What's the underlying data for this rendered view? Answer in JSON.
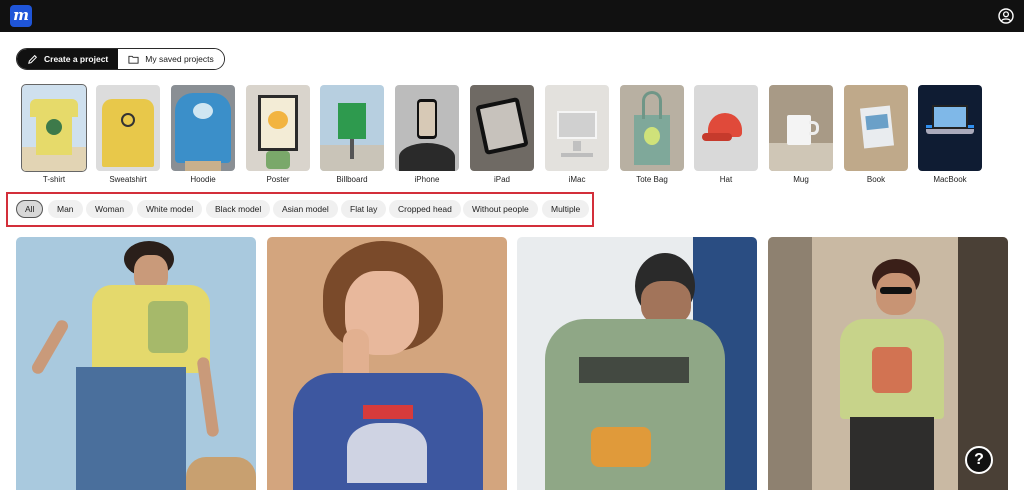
{
  "header": {
    "logo_letter": "m"
  },
  "projects": {
    "create_label": "Create a project",
    "saved_label": "My saved projects"
  },
  "categories": [
    {
      "label": "T-shirt"
    },
    {
      "label": "Sweatshirt"
    },
    {
      "label": "Hoodie"
    },
    {
      "label": "Poster"
    },
    {
      "label": "Billboard"
    },
    {
      "label": "iPhone"
    },
    {
      "label": "iPad"
    },
    {
      "label": "iMac"
    },
    {
      "label": "Tote Bag"
    },
    {
      "label": "Hat"
    },
    {
      "label": "Mug"
    },
    {
      "label": "Book"
    },
    {
      "label": "MacBook"
    }
  ],
  "filters": [
    {
      "label": "All"
    },
    {
      "label": "Man"
    },
    {
      "label": "Woman"
    },
    {
      "label": "White model"
    },
    {
      "label": "Black model"
    },
    {
      "label": "Asian model"
    },
    {
      "label": "Flat lay"
    },
    {
      "label": "Cropped head"
    },
    {
      "label": "Without people"
    },
    {
      "label": "Multiple"
    }
  ],
  "help": {
    "label": "?"
  },
  "colors": {
    "brand": "#1f55d8",
    "topbar": "#111111",
    "highlight": "#d32f3a"
  }
}
